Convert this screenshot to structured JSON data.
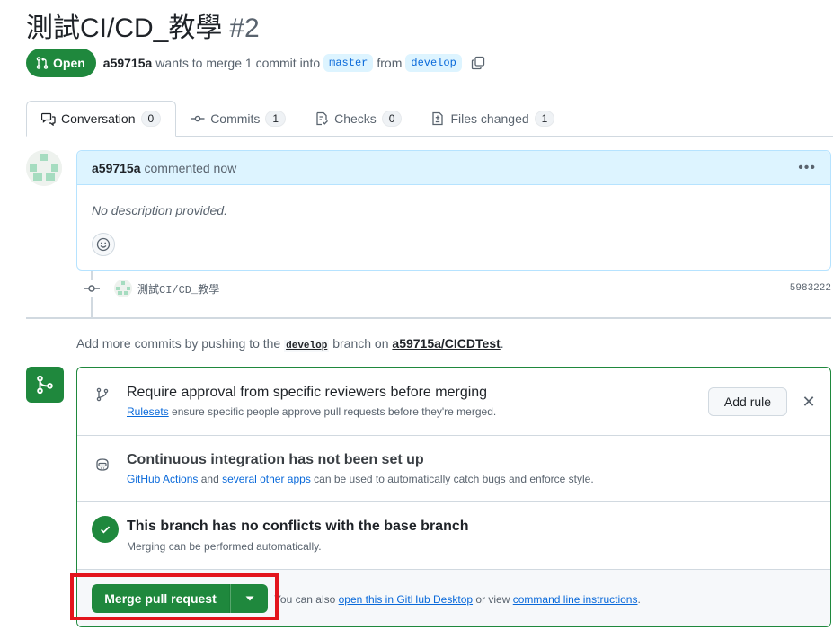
{
  "header": {
    "title": "測試CI/CD_教學",
    "number": "#2",
    "state": "Open",
    "author": "a59715a",
    "merge_text": "wants to merge 1 commit into",
    "base_branch": "master",
    "from_text": "from",
    "head_branch": "develop"
  },
  "tabs": [
    {
      "label": "Conversation",
      "count": "0",
      "icon": "comment-discussion-icon"
    },
    {
      "label": "Commits",
      "count": "1",
      "icon": "git-commit-icon"
    },
    {
      "label": "Checks",
      "count": "0",
      "icon": "checklist-icon"
    },
    {
      "label": "Files changed",
      "count": "1",
      "icon": "file-diff-icon"
    }
  ],
  "comment": {
    "author": "a59715a",
    "meta": "commented now",
    "body": "No description provided."
  },
  "commit": {
    "message": "測試CI/CD_教學",
    "sha": "5983222"
  },
  "push_hint": {
    "prefix": "Add more commits by pushing to the",
    "branch": "develop",
    "middle": "branch on",
    "repo": "a59715a/CICDTest",
    "suffix": "."
  },
  "merge_box": {
    "rules": {
      "title": "Require approval from specific reviewers before merging",
      "link": "Rulesets",
      "sub": "ensure specific people approve pull requests before they're merged.",
      "button": "Add rule"
    },
    "ci": {
      "title": "Continuous integration has not been set up",
      "link1": "GitHub Actions",
      "and": "and",
      "link2": "several other apps",
      "sub": "can be used to automatically catch bugs and enforce style."
    },
    "conflicts": {
      "title": "This branch has no conflicts with the base branch",
      "sub": "Merging can be performed automatically."
    },
    "merge": {
      "button": "Merge pull request",
      "note_prefix": "You can also",
      "link1": "open this in GitHub Desktop",
      "or": "or view",
      "link2": "command line instructions",
      "suffix": "."
    }
  },
  "colors": {
    "open_green": "#1f883d",
    "link_blue": "#0969da",
    "highlight_red": "#e3151c"
  }
}
